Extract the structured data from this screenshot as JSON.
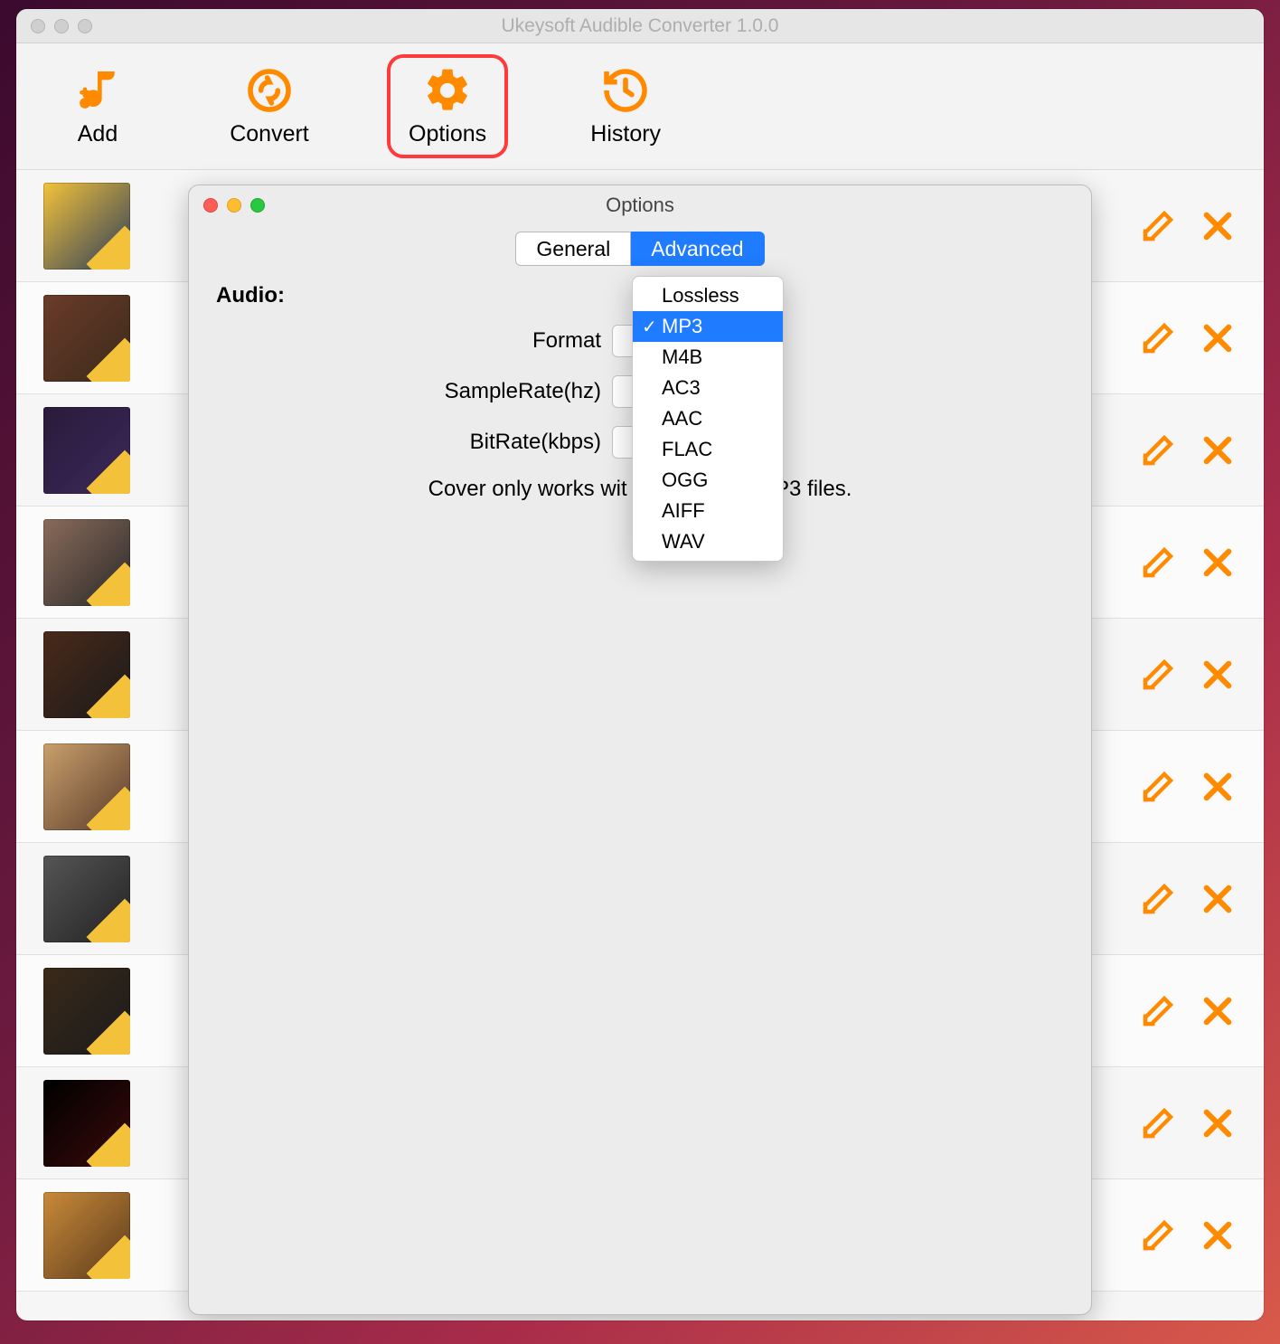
{
  "window": {
    "title": "Ukeysoft Audible Converter 1.0.0"
  },
  "toolbar": {
    "add": "Add",
    "convert": "Convert",
    "options": "Options",
    "history": "History",
    "highlighted": "options"
  },
  "options_dialog": {
    "title": "Options",
    "tabs": {
      "general": "General",
      "advanced": "Advanced",
      "active": "advanced"
    },
    "section_label": "Audio:",
    "fields": {
      "format_label": "Format",
      "samplerate_label": "SampleRate(hz)",
      "bitrate_label": "BitRate(kbps)"
    },
    "hint_left": "Cover only works wit",
    "hint_right": "MP3 files.",
    "format_dropdown": {
      "options": [
        "Lossless",
        "MP3",
        "M4B",
        "AC3",
        "AAC",
        "FLAC",
        "OGG",
        "AIFF",
        "WAV"
      ],
      "selected": "MP3"
    }
  },
  "file_list": {
    "rows": [
      {
        "cover": "cov-a"
      },
      {
        "cover": "cov-b"
      },
      {
        "cover": "cov-c"
      },
      {
        "cover": "cov-d"
      },
      {
        "cover": "cov-e"
      },
      {
        "cover": "cov-f"
      },
      {
        "cover": "cov-g"
      },
      {
        "cover": "cov-h"
      },
      {
        "cover": "cov-i"
      },
      {
        "cover": "cov-j"
      }
    ]
  }
}
